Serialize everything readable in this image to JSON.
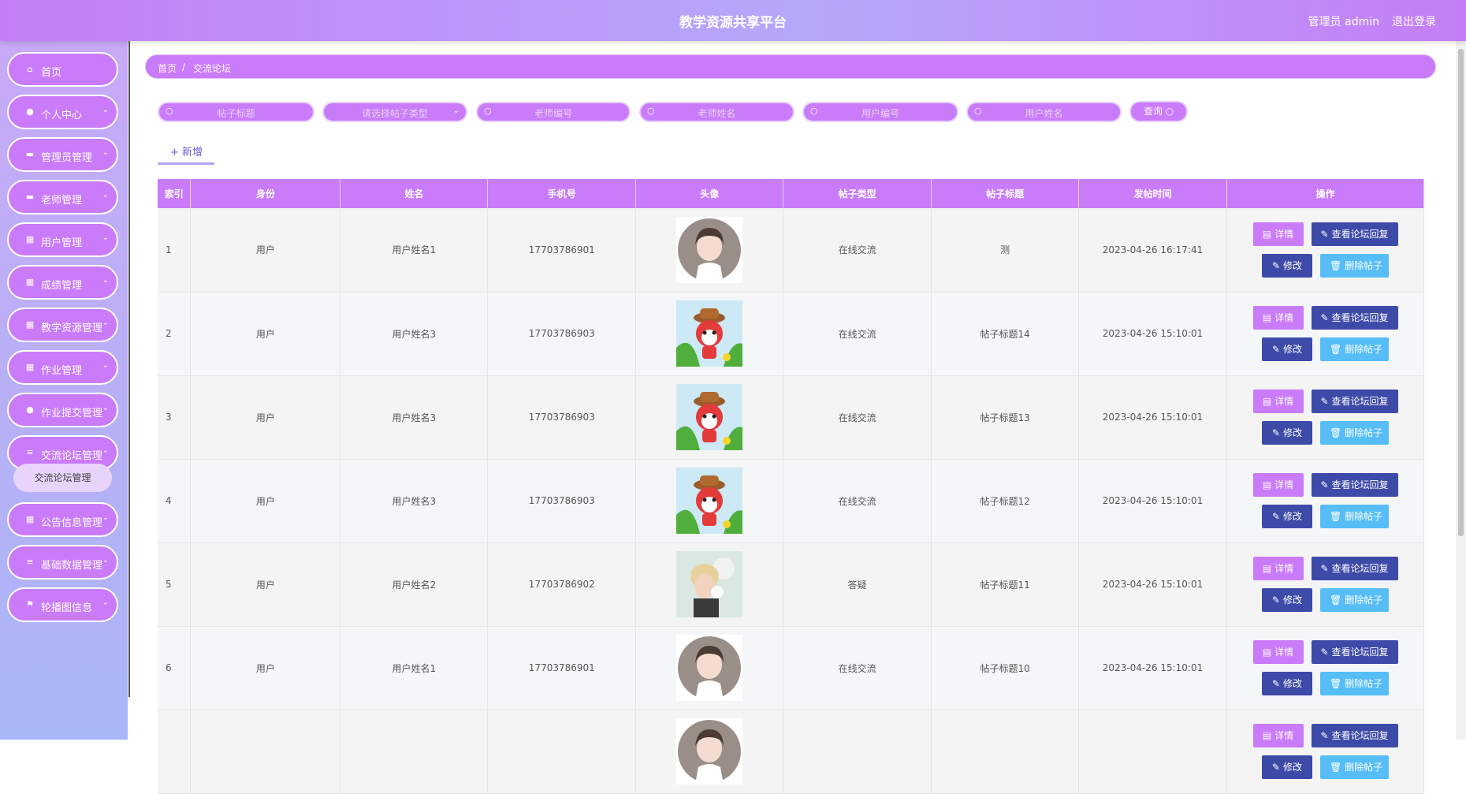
{
  "header": {
    "title": "教学资源共享平台",
    "user": "管理员 admin",
    "logout": "退出登录"
  },
  "sidebar": {
    "items": [
      {
        "label": "首页",
        "icon": "home-icon",
        "glyph": "⌂",
        "chevron": false,
        "top": 0
      },
      {
        "label": "个人中心",
        "icon": "user-icon",
        "glyph": "●",
        "chevron": true
      },
      {
        "label": "管理员管理",
        "icon": "monitor-icon",
        "glyph": "▬",
        "chevron": true
      },
      {
        "label": "老师管理",
        "icon": "monitor-icon",
        "glyph": "▬",
        "chevron": true
      },
      {
        "label": "用户管理",
        "icon": "grid-icon",
        "glyph": "▦",
        "chevron": true
      },
      {
        "label": "成绩管理",
        "icon": "grid-icon",
        "glyph": "▦",
        "chevron": true
      },
      {
        "label": "教学资源管理",
        "icon": "grid-icon",
        "glyph": "▦",
        "chevron": true
      },
      {
        "label": "作业管理",
        "icon": "grid-icon",
        "glyph": "▦",
        "chevron": true
      },
      {
        "label": "作业提交管理",
        "icon": "bulb-icon",
        "glyph": "●",
        "chevron": true
      },
      {
        "label": "交流论坛管理",
        "icon": "sliders-icon",
        "glyph": "≡",
        "chevron": true
      },
      {
        "label": "公告信息管理",
        "icon": "grid-icon",
        "glyph": "▦",
        "chevron": true
      },
      {
        "label": "基础数据管理",
        "icon": "list-icon",
        "glyph": "≡",
        "chevron": true
      },
      {
        "label": "轮播图信息",
        "icon": "flag-icon",
        "glyph": "⚑",
        "chevron": true
      }
    ],
    "submenu_active": "交流论坛管理"
  },
  "breadcrumb": {
    "home": "首页",
    "sep": "/",
    "current": "交流论坛"
  },
  "search": {
    "post_title": "帖子标题",
    "post_type": "请选择帖子类型",
    "teacher_no": "老师编号",
    "teacher_name": "老师姓名",
    "user_no": "用户编号",
    "user_name": "用户姓名",
    "query": "查询"
  },
  "add_label": "+ 新增",
  "table": {
    "headers": [
      "索引",
      "身份",
      "姓名",
      "手机号",
      "头像",
      "帖子类型",
      "帖子标题",
      "发帖时间",
      "操作"
    ],
    "rows": [
      {
        "idx": "1",
        "role": "用户",
        "name": "用户姓名1",
        "phone": "17703786901",
        "avatar": "girl",
        "type": "在线交流",
        "title": "测",
        "time": "2023-04-26 16:17:41"
      },
      {
        "idx": "2",
        "role": "用户",
        "name": "用户姓名3",
        "phone": "17703786903",
        "avatar": "fox",
        "type": "在线交流",
        "title": "帖子标题14",
        "time": "2023-04-26 15:10:01"
      },
      {
        "idx": "3",
        "role": "用户",
        "name": "用户姓名3",
        "phone": "17703786903",
        "avatar": "fox",
        "type": "在线交流",
        "title": "帖子标题13",
        "time": "2023-04-26 15:10:01"
      },
      {
        "idx": "4",
        "role": "用户",
        "name": "用户姓名3",
        "phone": "17703786903",
        "avatar": "fox",
        "type": "在线交流",
        "title": "帖子标题12",
        "time": "2023-04-26 15:10:01"
      },
      {
        "idx": "5",
        "role": "用户",
        "name": "用户姓名2",
        "phone": "17703786902",
        "avatar": "boy",
        "type": "答疑",
        "title": "帖子标题11",
        "time": "2023-04-26 15:10:01"
      },
      {
        "idx": "6",
        "role": "用户",
        "name": "用户姓名1",
        "phone": "17703786901",
        "avatar": "girl",
        "type": "在线交流",
        "title": "帖子标题10",
        "time": "2023-04-26 15:10:01"
      },
      {
        "idx": "",
        "role": "",
        "name": "",
        "phone": "",
        "avatar": "girl",
        "type": "",
        "title": "",
        "time": ""
      }
    ],
    "ops": {
      "detail": "详情",
      "reply": "查看论坛回复",
      "edit": "修改",
      "delete": "删除帖子"
    }
  },
  "colors": {
    "primary": "#c97bf9",
    "dark_button": "#3e4aa8",
    "danger_button": "#56bdf7"
  }
}
